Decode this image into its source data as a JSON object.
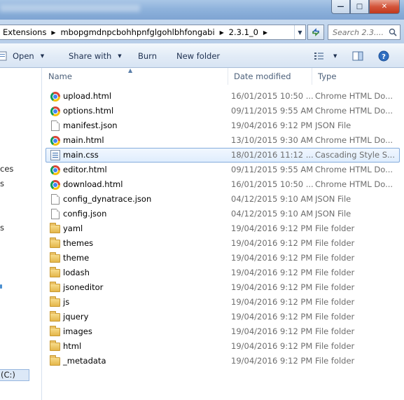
{
  "address": {
    "crumbs": [
      "Extensions",
      "mbopgmdnpcbohhpnfglgohlbhfongabi",
      "2.3.1_0"
    ],
    "search_placeholder": "Search 2.3...."
  },
  "toolbar": {
    "open_label": "Open",
    "share_label": "Share with",
    "burn_label": "Burn",
    "new_folder_label": "New folder"
  },
  "nav_fragments": [
    "ces",
    "s",
    "s",
    "(C:)"
  ],
  "columns": {
    "name": "Name",
    "date": "Date modified",
    "type": "Type"
  },
  "files": [
    {
      "name": "upload.html",
      "date": "16/01/2015 10:50 ...",
      "type": "Chrome HTML Do...",
      "icon": "chrome-icon"
    },
    {
      "name": "options.html",
      "date": "09/11/2015 9:55 AM",
      "type": "Chrome HTML Do...",
      "icon": "chrome-icon"
    },
    {
      "name": "manifest.json",
      "date": "19/04/2016 9:12 PM",
      "type": "JSON File",
      "icon": "file-icon"
    },
    {
      "name": "main.html",
      "date": "13/10/2015 9:30 AM",
      "type": "Chrome HTML Do...",
      "icon": "chrome-icon"
    },
    {
      "name": "main.css",
      "date": "18/01/2016 11:12 ...",
      "type": "Cascading Style S...",
      "icon": "css-file-icon",
      "selected": true
    },
    {
      "name": "editor.html",
      "date": "09/11/2015 9:55 AM",
      "type": "Chrome HTML Do...",
      "icon": "chrome-icon"
    },
    {
      "name": "download.html",
      "date": "16/01/2015 10:50 ...",
      "type": "Chrome HTML Do...",
      "icon": "chrome-icon"
    },
    {
      "name": "config_dynatrace.json",
      "date": "04/12/2015 9:10 AM",
      "type": "JSON File",
      "icon": "file-icon"
    },
    {
      "name": "config.json",
      "date": "04/12/2015 9:10 AM",
      "type": "JSON File",
      "icon": "file-icon"
    },
    {
      "name": "yaml",
      "date": "19/04/2016 9:12 PM",
      "type": "File folder",
      "icon": "folder-icon"
    },
    {
      "name": "themes",
      "date": "19/04/2016 9:12 PM",
      "type": "File folder",
      "icon": "folder-icon"
    },
    {
      "name": "theme",
      "date": "19/04/2016 9:12 PM",
      "type": "File folder",
      "icon": "folder-icon"
    },
    {
      "name": "lodash",
      "date": "19/04/2016 9:12 PM",
      "type": "File folder",
      "icon": "folder-icon"
    },
    {
      "name": "jsoneditor",
      "date": "19/04/2016 9:12 PM",
      "type": "File folder",
      "icon": "folder-icon"
    },
    {
      "name": "js",
      "date": "19/04/2016 9:12 PM",
      "type": "File folder",
      "icon": "folder-icon"
    },
    {
      "name": "jquery",
      "date": "19/04/2016 9:12 PM",
      "type": "File folder",
      "icon": "folder-icon"
    },
    {
      "name": "images",
      "date": "19/04/2016 9:12 PM",
      "type": "File folder",
      "icon": "folder-icon"
    },
    {
      "name": "html",
      "date": "19/04/2016 9:12 PM",
      "type": "File folder",
      "icon": "folder-icon"
    },
    {
      "name": "_metadata",
      "date": "19/04/2016 9:12 PM",
      "type": "File folder",
      "icon": "folder-icon"
    }
  ]
}
